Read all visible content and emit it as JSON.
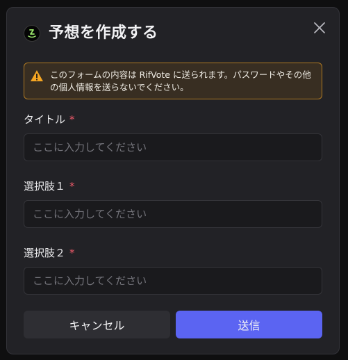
{
  "dialog": {
    "title": "予想を作成する",
    "close_icon": "close-icon",
    "logo_icon": "app-logo-icon"
  },
  "warning": {
    "icon": "warning-triangle-icon",
    "text": "このフォームの内容は RifVote に送られます。パスワードやその他の個人情報を送らないでください。",
    "colors": {
      "background": "#382e22",
      "border": "#b07a22",
      "icon": "#f5a623"
    }
  },
  "fields": {
    "title": {
      "label": "タイトル",
      "required_mark": "*",
      "placeholder": "ここに入力してください",
      "value": ""
    },
    "option1": {
      "label": "選択肢１",
      "required_mark": "*",
      "placeholder": "ここに入力してください",
      "value": ""
    },
    "option2": {
      "label": "選択肢２",
      "required_mark": "*",
      "placeholder": "ここに入力してください",
      "value": ""
    }
  },
  "buttons": {
    "cancel_label": "キャンセル",
    "submit_label": "送信"
  },
  "colors": {
    "accent": "#5b64f2",
    "required": "#ef5a6a",
    "modal_background": "#222226"
  }
}
